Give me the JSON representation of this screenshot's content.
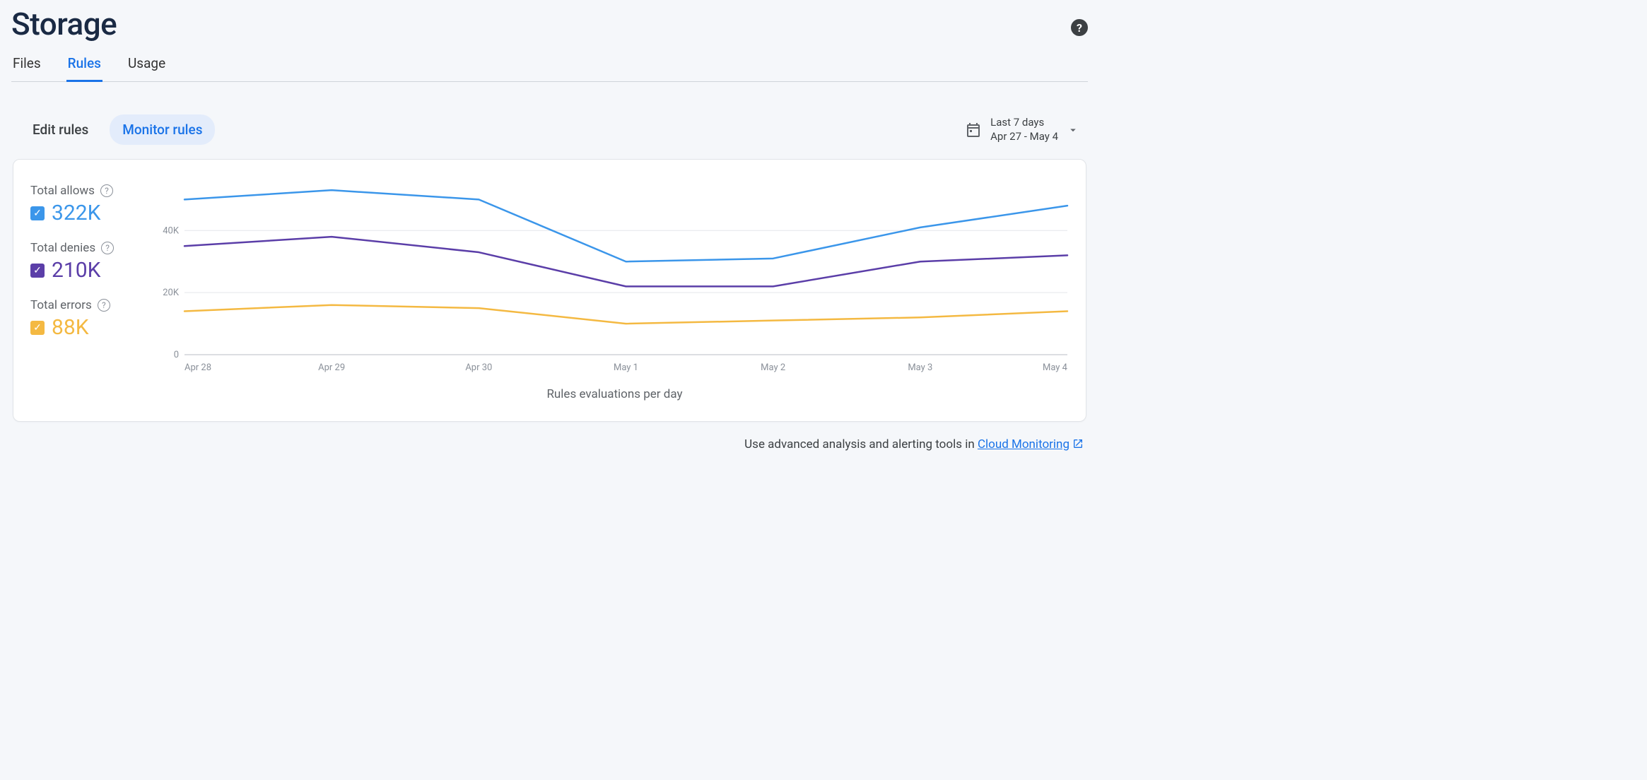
{
  "header": {
    "title": "Storage"
  },
  "tabs": {
    "items": [
      "Files",
      "Rules",
      "Usage"
    ],
    "active_index": 1
  },
  "sub_tabs": {
    "items": [
      "Edit rules",
      "Monitor rules"
    ],
    "active_index": 1
  },
  "date_range": {
    "label": "Last 7 days",
    "range": "Apr 27 - May 4"
  },
  "legend": [
    {
      "label": "Total allows",
      "value": "322K",
      "color": "#3b96ea"
    },
    {
      "label": "Total denies",
      "value": "210K",
      "color": "#5b3ea8"
    },
    {
      "label": "Total errors",
      "value": "88K",
      "color": "#f4b942"
    }
  ],
  "chart_data": {
    "type": "line",
    "xlabel": "Rules evaluations per day",
    "ylabel": "",
    "categories": [
      "Apr 28",
      "Apr 29",
      "Apr 30",
      "May 1",
      "May 2",
      "May 3",
      "May 4"
    ],
    "y_ticks": [
      0,
      20000,
      40000
    ],
    "y_tick_labels": [
      "0",
      "20K",
      "40K"
    ],
    "ylim": [
      0,
      56000
    ],
    "series": [
      {
        "name": "Total allows",
        "color": "#3b96ea",
        "values": [
          50000,
          53000,
          50000,
          30000,
          31000,
          41000,
          48000
        ]
      },
      {
        "name": "Total denies",
        "color": "#5b3ea8",
        "values": [
          35000,
          38000,
          33000,
          22000,
          22000,
          30000,
          32000
        ]
      },
      {
        "name": "Total errors",
        "color": "#f4b942",
        "values": [
          14000,
          16000,
          15000,
          10000,
          11000,
          12000,
          14000
        ]
      }
    ]
  },
  "footer": {
    "prefix": "Use advanced analysis and alerting tools in ",
    "link": "Cloud Monitoring"
  }
}
